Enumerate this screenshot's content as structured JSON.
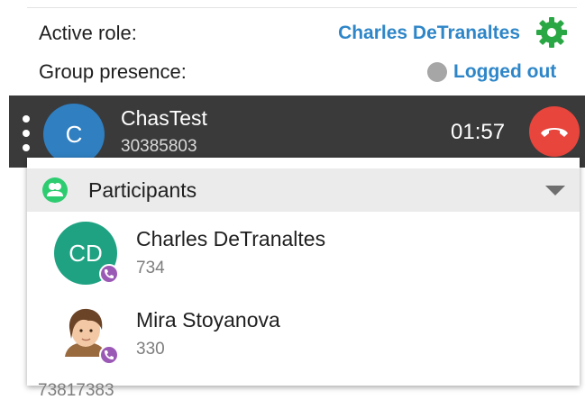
{
  "header": {
    "active_role_label": "Active role:",
    "active_role_value": "Charles DeTranaltes",
    "group_presence_label": "Group presence:",
    "group_presence_value": "Logged out"
  },
  "active_call": {
    "avatar_initial": "C",
    "name": "ChasTest",
    "number": "30385803",
    "timer": "01:57"
  },
  "participants_panel": {
    "title": "Participants",
    "items": [
      {
        "initials": "CD",
        "name": "Charles DeTranaltes",
        "extension": "734"
      },
      {
        "initials": "",
        "name": "Mira Stoyanova",
        "extension": "330"
      }
    ]
  },
  "footer": {
    "number": "73817383"
  },
  "colors": {
    "accent_blue": "#2e86c8",
    "gear_green": "#2aa745",
    "call_bar": "#3a3a3a",
    "hangup_red": "#e8453c",
    "participants_green": "#2ecc71",
    "avatar_teal": "#1fa282",
    "badge_purple": "#9b59b6"
  },
  "icons": {
    "settings": "gear-icon",
    "presence": "presence-dot-icon",
    "menu": "kebab-menu-icon",
    "hangup": "phone-hangup-icon",
    "participants": "participants-icon",
    "expand": "chevron-down-icon",
    "phone_badge": "phone-badge-icon"
  }
}
